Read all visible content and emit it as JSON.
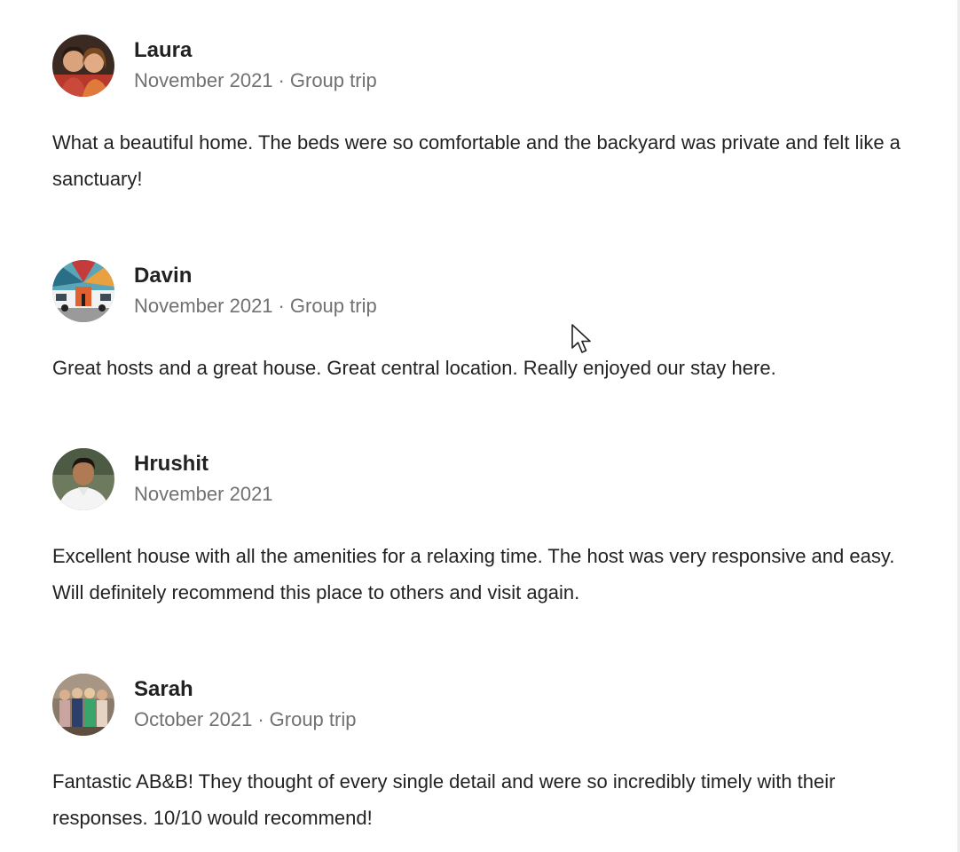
{
  "reviews": [
    {
      "name": "Laura",
      "date": "November 2021",
      "trip_type": "Group trip",
      "separator": "·",
      "text": "What a beautiful home. The beds were so comfortable and the backyard was private and felt like a sanctuary!",
      "avatar_icon": "avatar-photo-two-women"
    },
    {
      "name": "Davin",
      "date": "November 2021",
      "trip_type": "Group trip",
      "separator": "·",
      "text": "Great hosts and a great house. Great central location. Really enjoyed our stay here.",
      "avatar_icon": "avatar-photo-mural-van"
    },
    {
      "name": "Hrushit",
      "date": "November 2021",
      "trip_type": "",
      "separator": "",
      "text": "Excellent house with all the amenities for a relaxing time. The host was very responsive and easy. Will definitely recommend this place to others and visit again.",
      "avatar_icon": "avatar-photo-man"
    },
    {
      "name": "Sarah",
      "date": "October 2021",
      "trip_type": "Group trip",
      "separator": "·",
      "text": "Fantastic AB&B! They thought of every single detail and were so incredibly timely with their responses. 10/10 would recommend!",
      "avatar_icon": "avatar-photo-group"
    }
  ],
  "colors": {
    "text_primary": "#222222",
    "text_secondary": "#717171",
    "background": "#ffffff"
  },
  "cursor_icon": "mouse-pointer-icon"
}
